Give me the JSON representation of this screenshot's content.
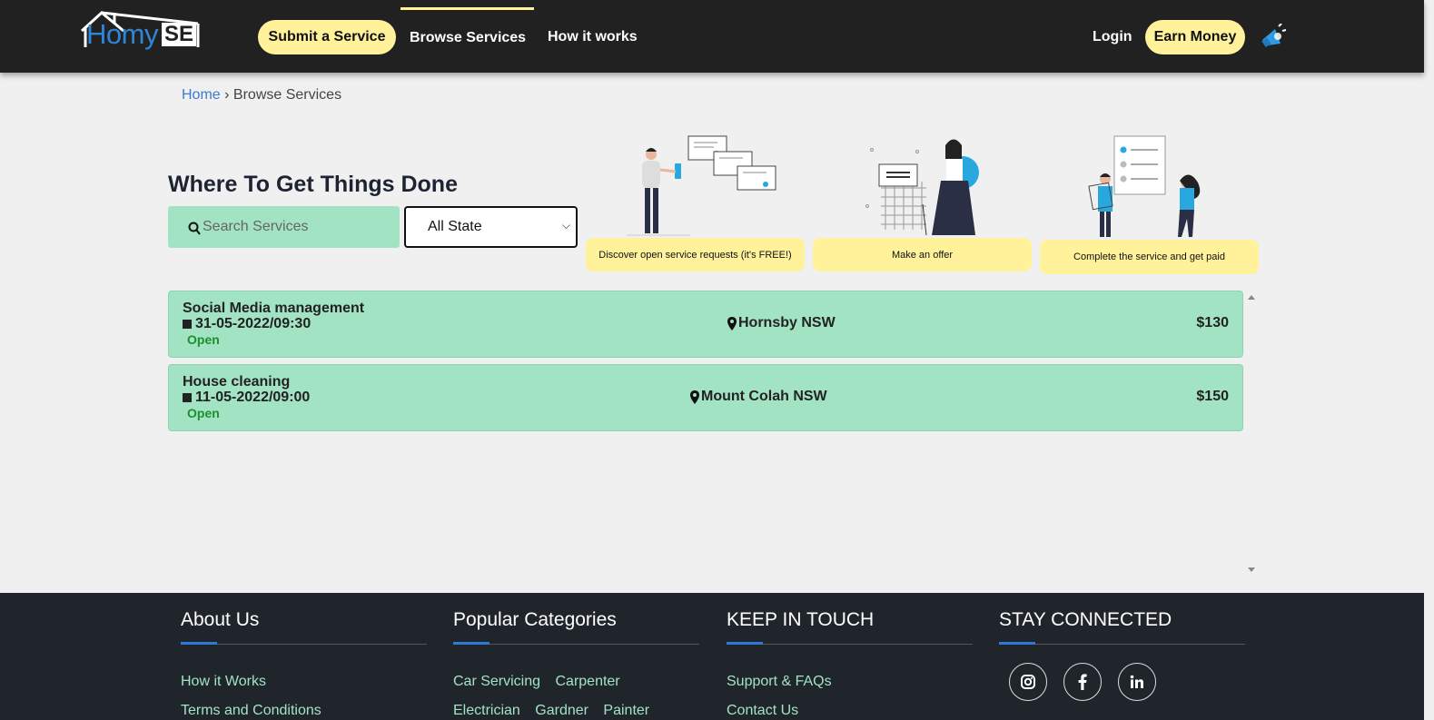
{
  "nav": {
    "logo_main": "Homy",
    "logo_suffix": "SE",
    "submit_label": "Submit a Service",
    "browse_label": "Browse Services",
    "how_label": "How it works",
    "login_label": "Login",
    "earn_label": "Earn Money"
  },
  "breadcrumb": {
    "home": "Home",
    "separator": "›",
    "current": "Browse Services"
  },
  "hero": {
    "title": "Where To Get Things Done",
    "search_placeholder": "Search Services",
    "state_selected": "All State",
    "steps": [
      "Discover open service requests (it's FREE!)",
      "Make an offer",
      "Complete the service and get paid"
    ]
  },
  "listings": [
    {
      "title": "Social Media management",
      "datetime": "31-05-2022/09:30",
      "status": "Open",
      "location": "Hornsby NSW",
      "price": "$130"
    },
    {
      "title": "House cleaning",
      "datetime": "11-05-2022/09:00",
      "status": "Open",
      "location": "Mount Colah NSW",
      "price": "$150"
    }
  ],
  "footer": {
    "about": {
      "heading": "About Us",
      "links": [
        "How it Works",
        "Terms and Conditions"
      ]
    },
    "categories": {
      "heading": "Popular Categories",
      "row1": [
        "Car Servicing",
        "Carpenter"
      ],
      "row2": [
        "Electrician",
        "Gardner",
        "Painter"
      ]
    },
    "touch": {
      "heading": "KEEP IN TOUCH",
      "links": [
        "Support & FAQs",
        "Contact Us"
      ]
    },
    "connected": {
      "heading": "STAY CONNECTED",
      "icons": [
        "instagram-icon",
        "facebook-icon",
        "linkedin-icon"
      ]
    }
  },
  "colors": {
    "nav_bg": "#212121",
    "accent_yellow": "#fff29b",
    "mint": "#a2e3c4",
    "footer_bg": "#1f252b",
    "link_blue": "#3a7bd5",
    "open_green": "#1f8f2d"
  }
}
